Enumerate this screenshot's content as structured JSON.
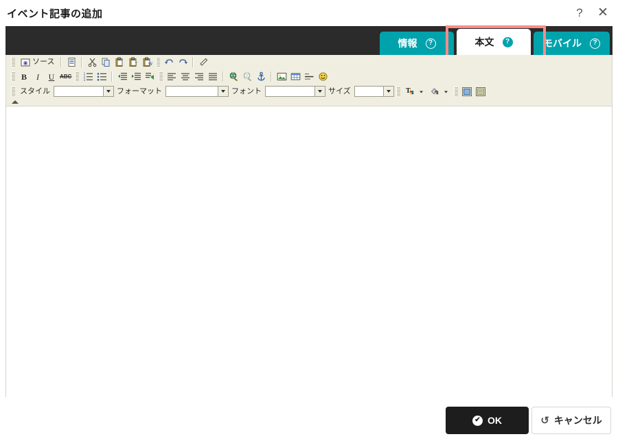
{
  "dialog": {
    "title": "イベント記事の追加",
    "help_button": "?",
    "close_button": "✕"
  },
  "tabs": [
    {
      "label": "情報",
      "help": "?",
      "active": false
    },
    {
      "label": "本文",
      "help": "?",
      "active": true
    },
    {
      "label": "モバイル",
      "help": "?",
      "active": false
    }
  ],
  "highlight": {
    "color": "#f98d88",
    "target": "本文"
  },
  "colors": {
    "tab_teal": "#00a3ac",
    "tab_bar_dark": "#2b2b2b",
    "toolbar_beige": "#efeee0",
    "ok_button": "#1d1d1d",
    "highlight_red": "#f98d88"
  },
  "toolbar": {
    "row1": [
      {
        "name": "source-button",
        "label": "ソース",
        "icon": "source-icon"
      },
      {
        "name": "new-page-button",
        "label": "",
        "icon": "new-page-icon"
      },
      {
        "name": "cut-button",
        "label": "",
        "icon": "scissors-icon"
      },
      {
        "name": "copy-button",
        "label": "",
        "icon": "copy-icon"
      },
      {
        "name": "paste-button",
        "label": "",
        "icon": "clipboard-icon"
      },
      {
        "name": "paste-text-button",
        "label": "",
        "icon": "clipboard-text-icon"
      },
      {
        "name": "paste-word-button",
        "label": "",
        "icon": "clipboard-word-icon"
      },
      {
        "name": "undo-button",
        "label": "",
        "icon": "undo-icon"
      },
      {
        "name": "redo-button",
        "label": "",
        "icon": "redo-icon"
      },
      {
        "name": "remove-format-button",
        "label": "",
        "icon": "eraser-icon"
      }
    ],
    "row2": [
      {
        "name": "bold-button",
        "label": "B",
        "icon": "bold-icon"
      },
      {
        "name": "italic-button",
        "label": "I",
        "icon": "italic-icon"
      },
      {
        "name": "underline-button",
        "label": "U",
        "icon": "underline-icon"
      },
      {
        "name": "strikethrough-button",
        "label": "ABC",
        "icon": "strikethrough-icon"
      },
      {
        "name": "numbered-list-button",
        "label": "",
        "icon": "numbered-list-icon"
      },
      {
        "name": "bulleted-list-button",
        "label": "",
        "icon": "bulleted-list-icon"
      },
      {
        "name": "outdent-button",
        "label": "",
        "icon": "outdent-icon"
      },
      {
        "name": "indent-button",
        "label": "",
        "icon": "indent-icon"
      },
      {
        "name": "blockquote-button",
        "label": "",
        "icon": "blockquote-icon"
      },
      {
        "name": "align-left-button",
        "label": "",
        "icon": "align-left-icon"
      },
      {
        "name": "align-center-button",
        "label": "",
        "icon": "align-center-icon"
      },
      {
        "name": "align-right-button",
        "label": "",
        "icon": "align-right-icon"
      },
      {
        "name": "align-justify-button",
        "label": "",
        "icon": "align-justify-icon"
      },
      {
        "name": "link-button",
        "label": "",
        "icon": "link-globe-icon"
      },
      {
        "name": "unlink-button",
        "label": "",
        "icon": "unlink-icon"
      },
      {
        "name": "anchor-button",
        "label": "",
        "icon": "anchor-icon"
      },
      {
        "name": "image-button",
        "label": "",
        "icon": "image-icon"
      },
      {
        "name": "table-button",
        "label": "",
        "icon": "table-icon"
      },
      {
        "name": "horizontal-rule-button",
        "label": "",
        "icon": "horizontal-rule-icon"
      },
      {
        "name": "smiley-button",
        "label": "",
        "icon": "smiley-icon"
      }
    ],
    "row3": {
      "style_label": "スタイル",
      "style_value": "",
      "format_label": "フォーマット",
      "format_value": "",
      "font_label": "フォント",
      "font_value": "",
      "size_label": "サイズ",
      "size_value": "",
      "text_color_icon": "text-color-icon",
      "bg_color_icon": "background-color-icon",
      "show_blocks_icon": "show-blocks-icon",
      "templates_icon": "templates-icon"
    }
  },
  "editor": {
    "content": "",
    "placeholder": ""
  },
  "footer": {
    "ok_label": "OK",
    "ok_icon": "check-circle-icon",
    "cancel_label": "キャンセル",
    "cancel_icon": "undo-arrow-icon"
  }
}
